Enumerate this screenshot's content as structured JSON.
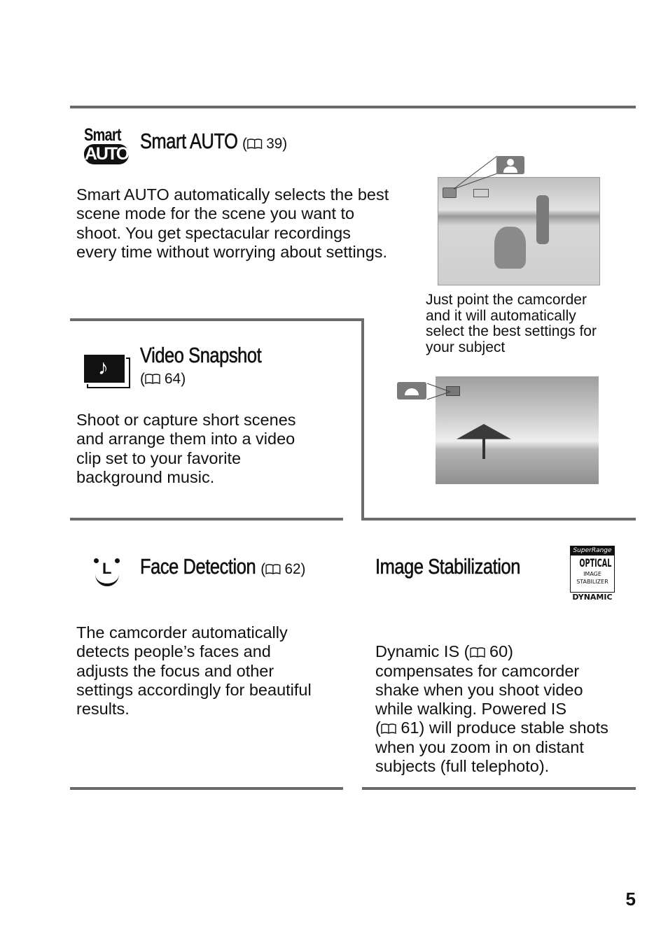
{
  "sections": {
    "smart_auto": {
      "logo_text_top": "Smart",
      "logo_text_bottom": "AUTO",
      "title": "Smart AUTO",
      "ref_open": "(",
      "ref_page": "39)",
      "body": "Smart AUTO automatically selects the best\nscene mode for the scene you want to\nshoot. You get spectacular recordings\nevery time without worrying about settings.",
      "caption": "Just point the camcorder\nand it will automatically\nselect the best settings for\nyour subject"
    },
    "video_snapshot": {
      "title": "Video Snapshot",
      "ref_open": "(",
      "ref_page": "64)",
      "body": "Shoot or capture short scenes\nand arrange them into a video\nclip set to your favorite\nbackground music."
    },
    "face_detection": {
      "title": "Face Detection",
      "ref_open": "(",
      "ref_page": "62)",
      "body": "The camcorder automatically\ndetects people’s faces and\nadjusts the focus and other\nsettings accordingly for beautiful\nresults."
    },
    "image_stabilization": {
      "title": "Image Stabilization",
      "logo_lines": [
        "SuperRange",
        "OPTICAL",
        "IMAGE",
        "STABILIZER",
        "DYNAMIC"
      ],
      "body_1": "Dynamic IS (",
      "body_1b": "60)",
      "body_2": "compensates for camcorder\nshake when you shoot video\nwhile walking. Powered IS",
      "body_3a": "(",
      "body_3b": "61) will produce stable shots",
      "body_4": "when you zoom in on distant\nsubjects (full telephoto)."
    }
  },
  "page_number": "5",
  "colors": {
    "rule": "#6b6b6b",
    "icon_badge": "#7a7a7a"
  }
}
